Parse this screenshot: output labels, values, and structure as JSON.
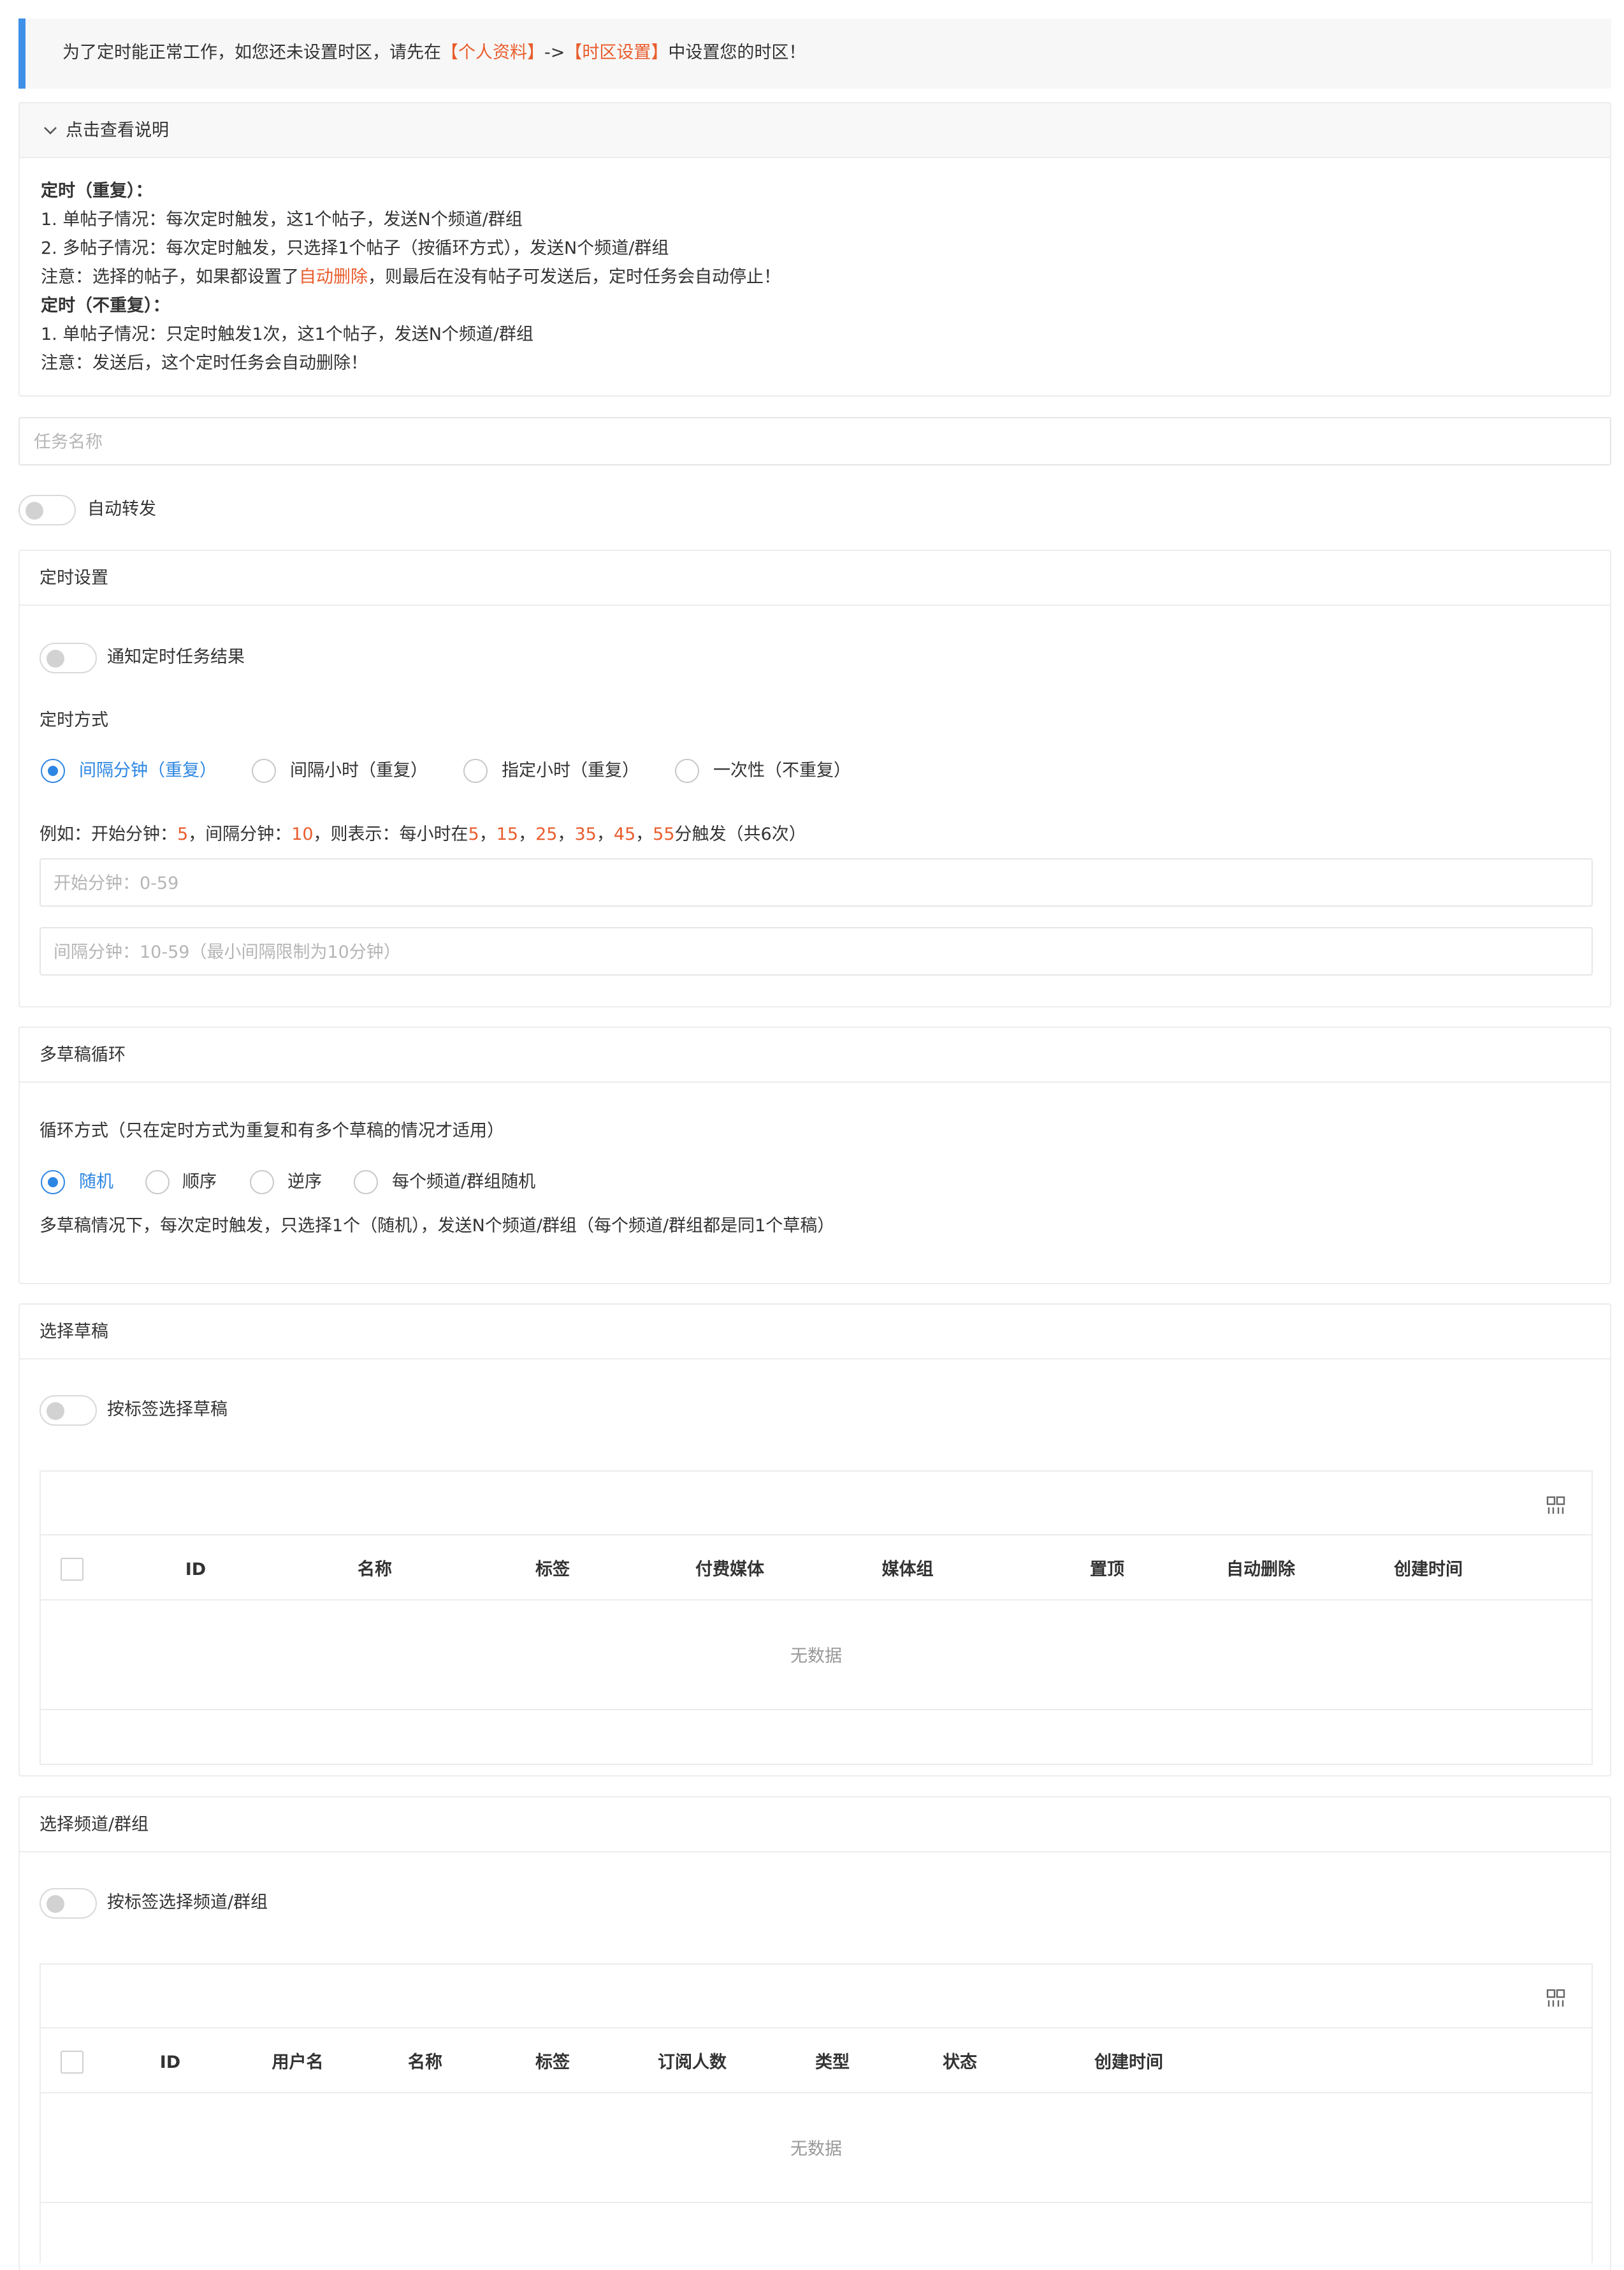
{
  "notice": {
    "pre": "为了定时能正常工作，如您还未设置时区，请先在",
    "link1": "【个人资料】",
    "arrow": "->",
    "link2": "【时区设置】",
    "post": "中设置您的时区！"
  },
  "help": {
    "toggle_label": "点击查看说明",
    "l1": "定时（重复）：",
    "l2": "1. 单帖子情况：每次定时触发，这1个帖子，发送N个频道/群组",
    "l3": "2. 多帖子情况：每次定时触发，只选择1个帖子（按循环方式），发送N个频道/群组",
    "l4_pre": "注意：选择的帖子，如果都设置了",
    "l4_hl": "自动删除",
    "l4_post": "，则最后在没有帖子可发送后，定时任务会自动停止！",
    "l5": "定时（不重复）：",
    "l6": "1. 单帖子情况：只定时触发1次，这1个帖子，发送N个频道/群组",
    "l7": "注意：发送后，这个定时任务会自动删除！"
  },
  "task_name": {
    "placeholder": "任务名称"
  },
  "auto_forward": {
    "label": "自动转发"
  },
  "schedule": {
    "title": "定时设置",
    "notify_label": "通知定时任务结果",
    "mode_label": "定时方式",
    "options": [
      "间隔分钟（重复）",
      "间隔小时（重复）",
      "指定小时（重复）",
      "一次性（不重复）"
    ],
    "example": {
      "p1": "例如：开始分钟：",
      "v1": "5",
      "p2": "，间隔分钟：",
      "v2": "10",
      "p3": "，则表示：每小时在",
      "m1": "5",
      "sep": "，",
      "m2": "15",
      "m3": "25",
      "m4": "35",
      "m5": "45",
      "m6": "55",
      "p4": "分触发（共6次）"
    },
    "start_placeholder": "开始分钟：0-59",
    "interval_placeholder": "间隔分钟：10-59（最小间隔限制为10分钟）"
  },
  "loop": {
    "title": "多草稿循环",
    "mode_label": "循环方式（只在定时方式为重复和有多个草稿的情况才适用）",
    "options": [
      "随机",
      "顺序",
      "逆序",
      "每个频道/群组随机"
    ],
    "desc": "多草稿情况下，每次定时触发，只选择1个（随机），发送N个频道/群组（每个频道/群组都是同1个草稿）"
  },
  "drafts": {
    "title": "选择草稿",
    "tag_toggle": "按标签选择草稿",
    "columns": [
      "ID",
      "名称",
      "标签",
      "付费媒体",
      "媒体组",
      "置顶",
      "自动删除",
      "创建时间"
    ],
    "empty": "无数据"
  },
  "channels": {
    "title": "选择频道/群组",
    "tag_toggle": "按标签选择频道/群组",
    "columns": [
      "ID",
      "用户名",
      "名称",
      "标签",
      "订阅人数",
      "类型",
      "状态",
      "创建时间"
    ],
    "empty": "无数据"
  }
}
